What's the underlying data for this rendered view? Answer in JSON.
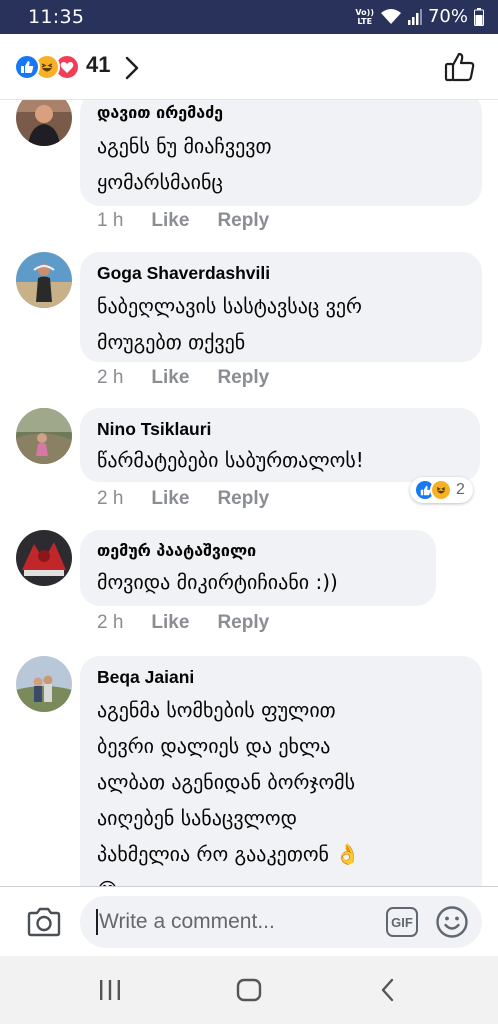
{
  "status_bar": {
    "time": "11:35",
    "volte_top": "Vo))",
    "volte_bottom": "LTE",
    "battery": "70%"
  },
  "reactions": {
    "count": "41"
  },
  "comments": [
    {
      "author": "დავით ირემაძე",
      "lines": [
        "აგენს ნუ მიაჩვევთ",
        "ყომარსმაინც"
      ],
      "time": "1 h",
      "like": "Like",
      "reply": "Reply"
    },
    {
      "author": "Goga Shaverdashvili",
      "lines": [
        "ნაბეღლავის სასტავსაც ვერ",
        "მოუგებთ თქვენ"
      ],
      "time": "2 h",
      "like": "Like",
      "reply": "Reply"
    },
    {
      "author": "Nino Tsiklauri",
      "lines": [
        "წარმატებები საბურთალოს!"
      ],
      "time": "2 h",
      "like": "Like",
      "reply": "Reply",
      "reaction_count": "2"
    },
    {
      "author": "თემურ პაატაშვილი",
      "lines": [
        "მოვიდა მიკირტიჩიანი :))"
      ],
      "time": "2 h",
      "like": "Like",
      "reply": "Reply"
    },
    {
      "author": "Beqa Jaiani",
      "lines": [
        "აგენმა სომხების ფულით",
        "ბევრი დალიეს და ეხლა",
        "ალბათ აგენიდან ბორჯომს",
        "აიღებენ სანაცვლოდ",
        "პახმელია რო გააკეთონ 👌",
        "😁"
      ]
    }
  ],
  "composer": {
    "placeholder": "Write a comment...",
    "gif_label": "GIF"
  },
  "colors": {
    "status_bar": "#29325a",
    "bubble": "#f0f2f5",
    "like_blue": "#1877f2",
    "meta_gray": "#8a8d91"
  }
}
